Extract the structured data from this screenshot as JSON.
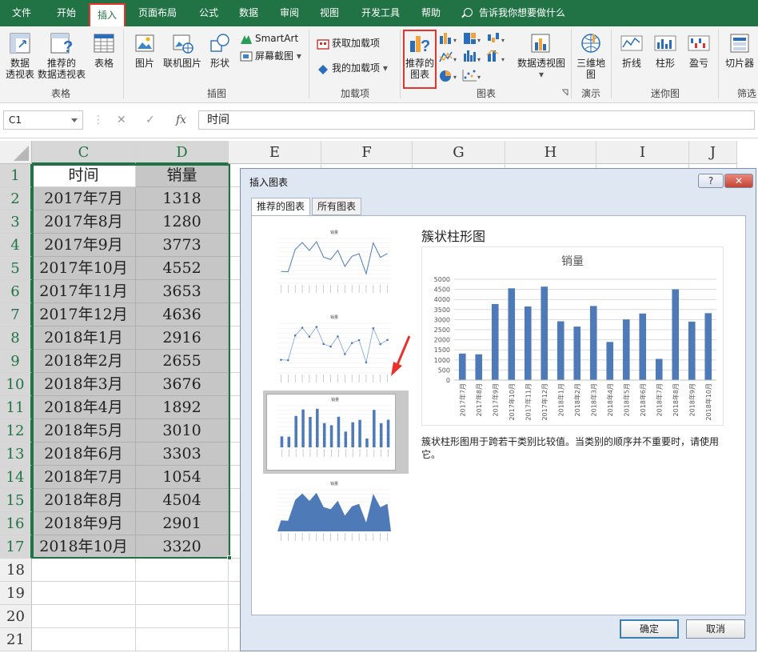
{
  "tabs": [
    "文件",
    "开始",
    "插入",
    "页面布局",
    "公式",
    "数据",
    "审阅",
    "视图",
    "开发工具",
    "帮助"
  ],
  "active_tab": "插入",
  "tell_me": "告诉我你想要做什么",
  "ribbon": {
    "pivot_table": "数据\n透视表",
    "recommended_pivot": "推荐的\n数据透视表",
    "table": "表格",
    "group_tables": "表格",
    "picture": "图片",
    "online_picture": "联机图片",
    "shapes": "形状",
    "smartart": "SmartArt",
    "screenshot": "屏幕截图",
    "group_illustrations": "插图",
    "get_addins": "获取加载项",
    "my_addins": "我的加载项",
    "group_addins": "加载项",
    "recommended_charts": "推荐的\n图表",
    "pivot_chart": "数据透视图",
    "group_charts": "图表",
    "map_3d": "三维地\n图",
    "group_tours": "演示",
    "spark_line": "折线",
    "spark_column": "柱形",
    "spark_winloss": "盈亏",
    "group_sparklines": "迷你图",
    "slicer": "切片器",
    "group_filters": "筛选"
  },
  "formula_bar": {
    "name_box": "C1",
    "fx": "fx",
    "formula": "时间"
  },
  "columns": [
    "C",
    "D",
    "E",
    "F",
    "G",
    "H",
    "I",
    "J"
  ],
  "rows": [
    "1",
    "2",
    "3",
    "4",
    "5",
    "6",
    "7",
    "8",
    "9",
    "10",
    "11",
    "12",
    "13",
    "14",
    "15",
    "16",
    "17",
    "18",
    "19",
    "20",
    "21"
  ],
  "table": {
    "header": [
      "时间",
      "销量"
    ],
    "data": [
      [
        "2017年7月",
        "1318"
      ],
      [
        "2017年8月",
        "1280"
      ],
      [
        "2017年9月",
        "3773"
      ],
      [
        "2017年10月",
        "4552"
      ],
      [
        "2017年11月",
        "3653"
      ],
      [
        "2017年12月",
        "4636"
      ],
      [
        "2018年1月",
        "2916"
      ],
      [
        "2018年2月",
        "2655"
      ],
      [
        "2018年3月",
        "3676"
      ],
      [
        "2018年4月",
        "1892"
      ],
      [
        "2018年5月",
        "3010"
      ],
      [
        "2018年6月",
        "3303"
      ],
      [
        "2018年7月",
        "1054"
      ],
      [
        "2018年8月",
        "4504"
      ],
      [
        "2018年9月",
        "2901"
      ],
      [
        "2018年10月",
        "3320"
      ]
    ]
  },
  "dialog": {
    "title": "插入图表",
    "help": "?",
    "close": "✕",
    "tab_recommended": "推荐的图表",
    "tab_all": "所有图表",
    "preview_title": "簇状柱形图",
    "description": "簇状柱形图用于跨若干类别比较值。当类别的顺序并不重要时，请使用它。",
    "ok": "确定",
    "cancel": "取消"
  },
  "chart_data": {
    "type": "bar",
    "title": "销量",
    "categories": [
      "2017年7月",
      "2017年8月",
      "2017年9月",
      "2017年10月",
      "2017年11月",
      "2017年12月",
      "2018年1月",
      "2018年2月",
      "2018年3月",
      "2018年4月",
      "2018年5月",
      "2018年6月",
      "2018年7月",
      "2018年8月",
      "2018年9月",
      "2018年10月"
    ],
    "values": [
      1318,
      1280,
      3773,
      4552,
      3653,
      4636,
      2916,
      2655,
      3676,
      1892,
      3010,
      3303,
      1054,
      4504,
      2901,
      3320
    ],
    "ylim": [
      0,
      5000
    ],
    "yticks": [
      "0",
      "500",
      "1000",
      "1500",
      "2000",
      "2500",
      "3000",
      "3500",
      "4000",
      "4500",
      "5000"
    ],
    "grid": true,
    "color": "#4e7ab8"
  },
  "colors": {
    "excel_green": "#217346",
    "highlight_red": "#e8322c",
    "bar_blue": "#4e7ab8"
  }
}
